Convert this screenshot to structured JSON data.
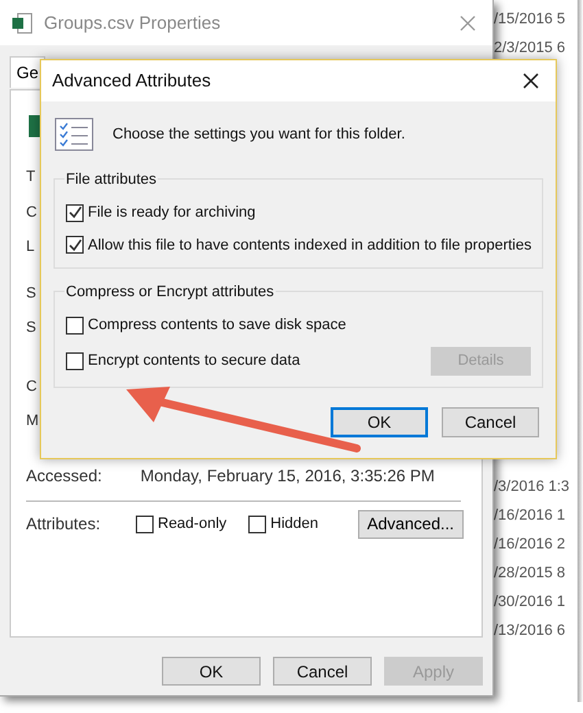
{
  "back_window": {
    "title": "Groups.csv Properties",
    "tab": "Ge",
    "label_fragments": [
      "T",
      "C",
      "L",
      "S",
      "S",
      "C",
      "M"
    ],
    "accessed": {
      "label": "Accessed:",
      "value": "Monday, February 15, 2016, 3:35:26 PM"
    },
    "attributes": {
      "label": "Attributes:",
      "checkboxes": [
        {
          "label": "Read-only",
          "checked": false
        },
        {
          "label": "Hidden",
          "checked": false
        }
      ],
      "button": "Advanced..."
    },
    "buttons": [
      {
        "label": "OK",
        "disabled": false
      },
      {
        "label": "Cancel",
        "disabled": false
      },
      {
        "label": "Apply",
        "disabled": true
      }
    ]
  },
  "explorer_dates_top": [
    "/15/2016 5",
    "2/3/2015 6"
  ],
  "explorer_dates_bottom": [
    "/3/2016 1:3",
    "/16/2016 1",
    "/16/2016 2",
    "/28/2015 8",
    "/30/2016 1",
    "/13/2016 6"
  ],
  "dialog": {
    "title": "Advanced Attributes",
    "intro": "Choose the settings you want for this folder.",
    "groups": [
      {
        "title": "File attributes",
        "options": [
          {
            "label": "File is ready for archiving",
            "checked": true
          },
          {
            "label": "Allow this file to have contents indexed in addition to file properties",
            "checked": true
          }
        ]
      },
      {
        "title": "Compress or Encrypt attributes",
        "options": [
          {
            "label": "Compress contents to save disk space",
            "checked": false
          },
          {
            "label": "Encrypt contents to secure data",
            "checked": false
          }
        ],
        "button": {
          "label": "Details",
          "disabled": true
        }
      }
    ],
    "buttons": [
      {
        "label": "OK",
        "default": true
      },
      {
        "label": "Cancel",
        "default": false
      }
    ]
  }
}
